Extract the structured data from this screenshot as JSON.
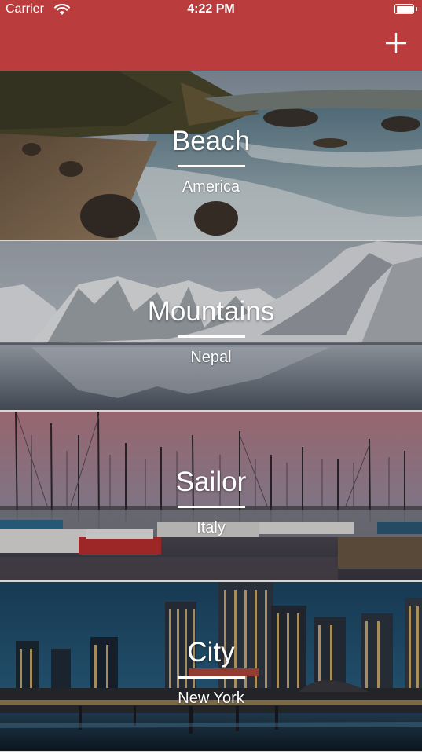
{
  "status_bar": {
    "carrier": "Carrier",
    "time": "4:22 PM",
    "wifi_icon": "wifi-icon",
    "battery_icon": "battery-icon"
  },
  "nav": {
    "background_color": "#bb3c3c",
    "add_icon": "plus-icon"
  },
  "cards": [
    {
      "title": "Beach",
      "subtitle": "America",
      "image": "beach-photo"
    },
    {
      "title": "Mountains",
      "subtitle": "Nepal",
      "image": "mountains-photo"
    },
    {
      "title": "Sailor",
      "subtitle": "Italy",
      "image": "harbor-photo"
    },
    {
      "title": "City",
      "subtitle": "New York",
      "image": "city-night-photo"
    }
  ]
}
